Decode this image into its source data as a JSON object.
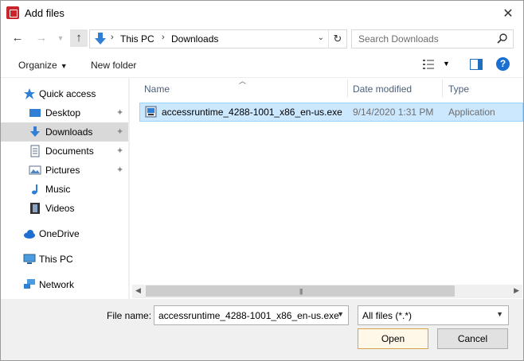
{
  "window": {
    "title": "Add files"
  },
  "nav_bar": {
    "path": [
      "This PC",
      "Downloads"
    ],
    "search_placeholder": "Search Downloads"
  },
  "toolbar": {
    "organize_label": "Organize",
    "new_folder_label": "New folder"
  },
  "sidebar": {
    "items": [
      {
        "label": "Quick access",
        "icon": "star-icon",
        "pinned": false
      },
      {
        "label": "Desktop",
        "icon": "desktop-icon",
        "pinned": true
      },
      {
        "label": "Downloads",
        "icon": "download-icon",
        "pinned": true,
        "selected": true
      },
      {
        "label": "Documents",
        "icon": "document-icon",
        "pinned": true
      },
      {
        "label": "Pictures",
        "icon": "pictures-icon",
        "pinned": true
      },
      {
        "label": "Music",
        "icon": "music-icon",
        "pinned": false
      },
      {
        "label": "Videos",
        "icon": "video-icon",
        "pinned": false
      },
      {
        "label": "OneDrive",
        "icon": "cloud-icon",
        "pinned": false
      },
      {
        "label": "This PC",
        "icon": "computer-icon",
        "pinned": false
      },
      {
        "label": "Network",
        "icon": "network-icon",
        "pinned": false
      }
    ]
  },
  "file_list": {
    "columns": [
      "Name",
      "Date modified",
      "Type"
    ],
    "rows": [
      {
        "name": "accessruntime_4288-1001_x86_en-us.exe",
        "date": "9/14/2020 1:31 PM",
        "type": "Application",
        "selected": true
      }
    ]
  },
  "bottom": {
    "file_name_label": "File name:",
    "file_name_value": "accessruntime_4288-1001_x86_en-us.exe",
    "filter_value": "All files (*.*)",
    "open_label": "Open",
    "cancel_label": "Cancel"
  },
  "colors": {
    "selection": "#cce8ff",
    "accent": "#1a6fd0"
  }
}
